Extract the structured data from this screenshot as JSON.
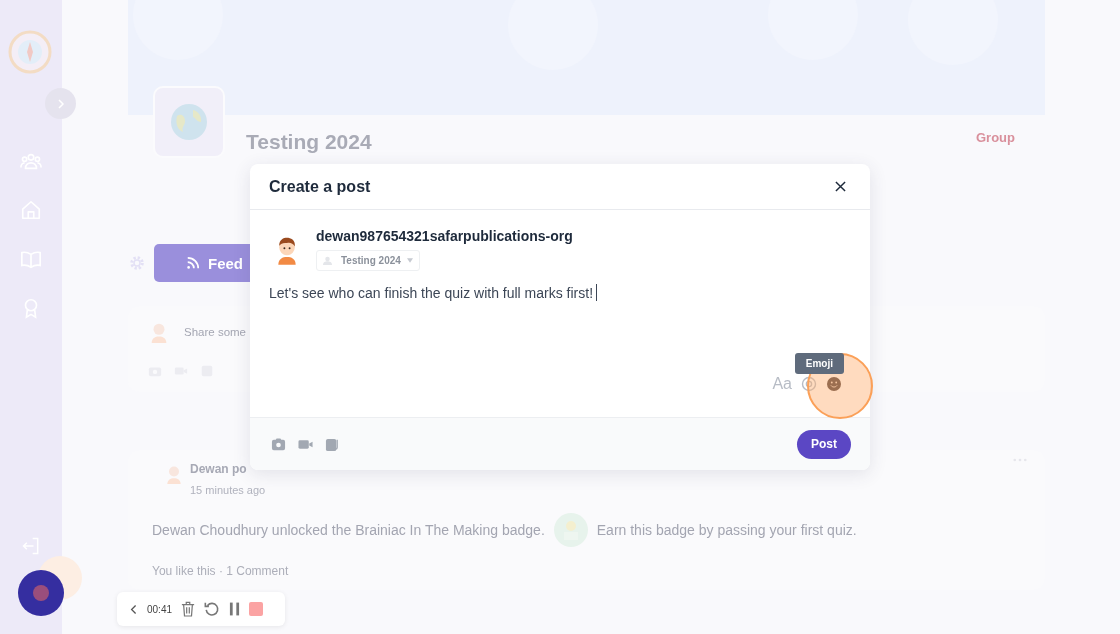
{
  "group": {
    "title": "Testing 2024",
    "type_label": "Group"
  },
  "tabs": [
    {
      "label": "Feed",
      "selected": true
    }
  ],
  "composer": {
    "placeholder": "Share some"
  },
  "feed": [
    {
      "author_line": "Dewan po",
      "time": "15 minutes ago",
      "message": "Dewan Choudhury unlocked the Brainiac In The Making badge.",
      "badge_note": "Earn this badge by passing your first quiz.",
      "reactions": "You like this · 1 Comment"
    }
  ],
  "dialog": {
    "title": "Create a post",
    "username": "dewan987654321safarpublications-org",
    "audience": "Testing 2024",
    "text": "Let's see who can finish the quiz with full marks first!",
    "tooltip": "Emoji",
    "format_button": "Aa",
    "post_button": "Post"
  },
  "recorder": {
    "time": "00:41"
  }
}
